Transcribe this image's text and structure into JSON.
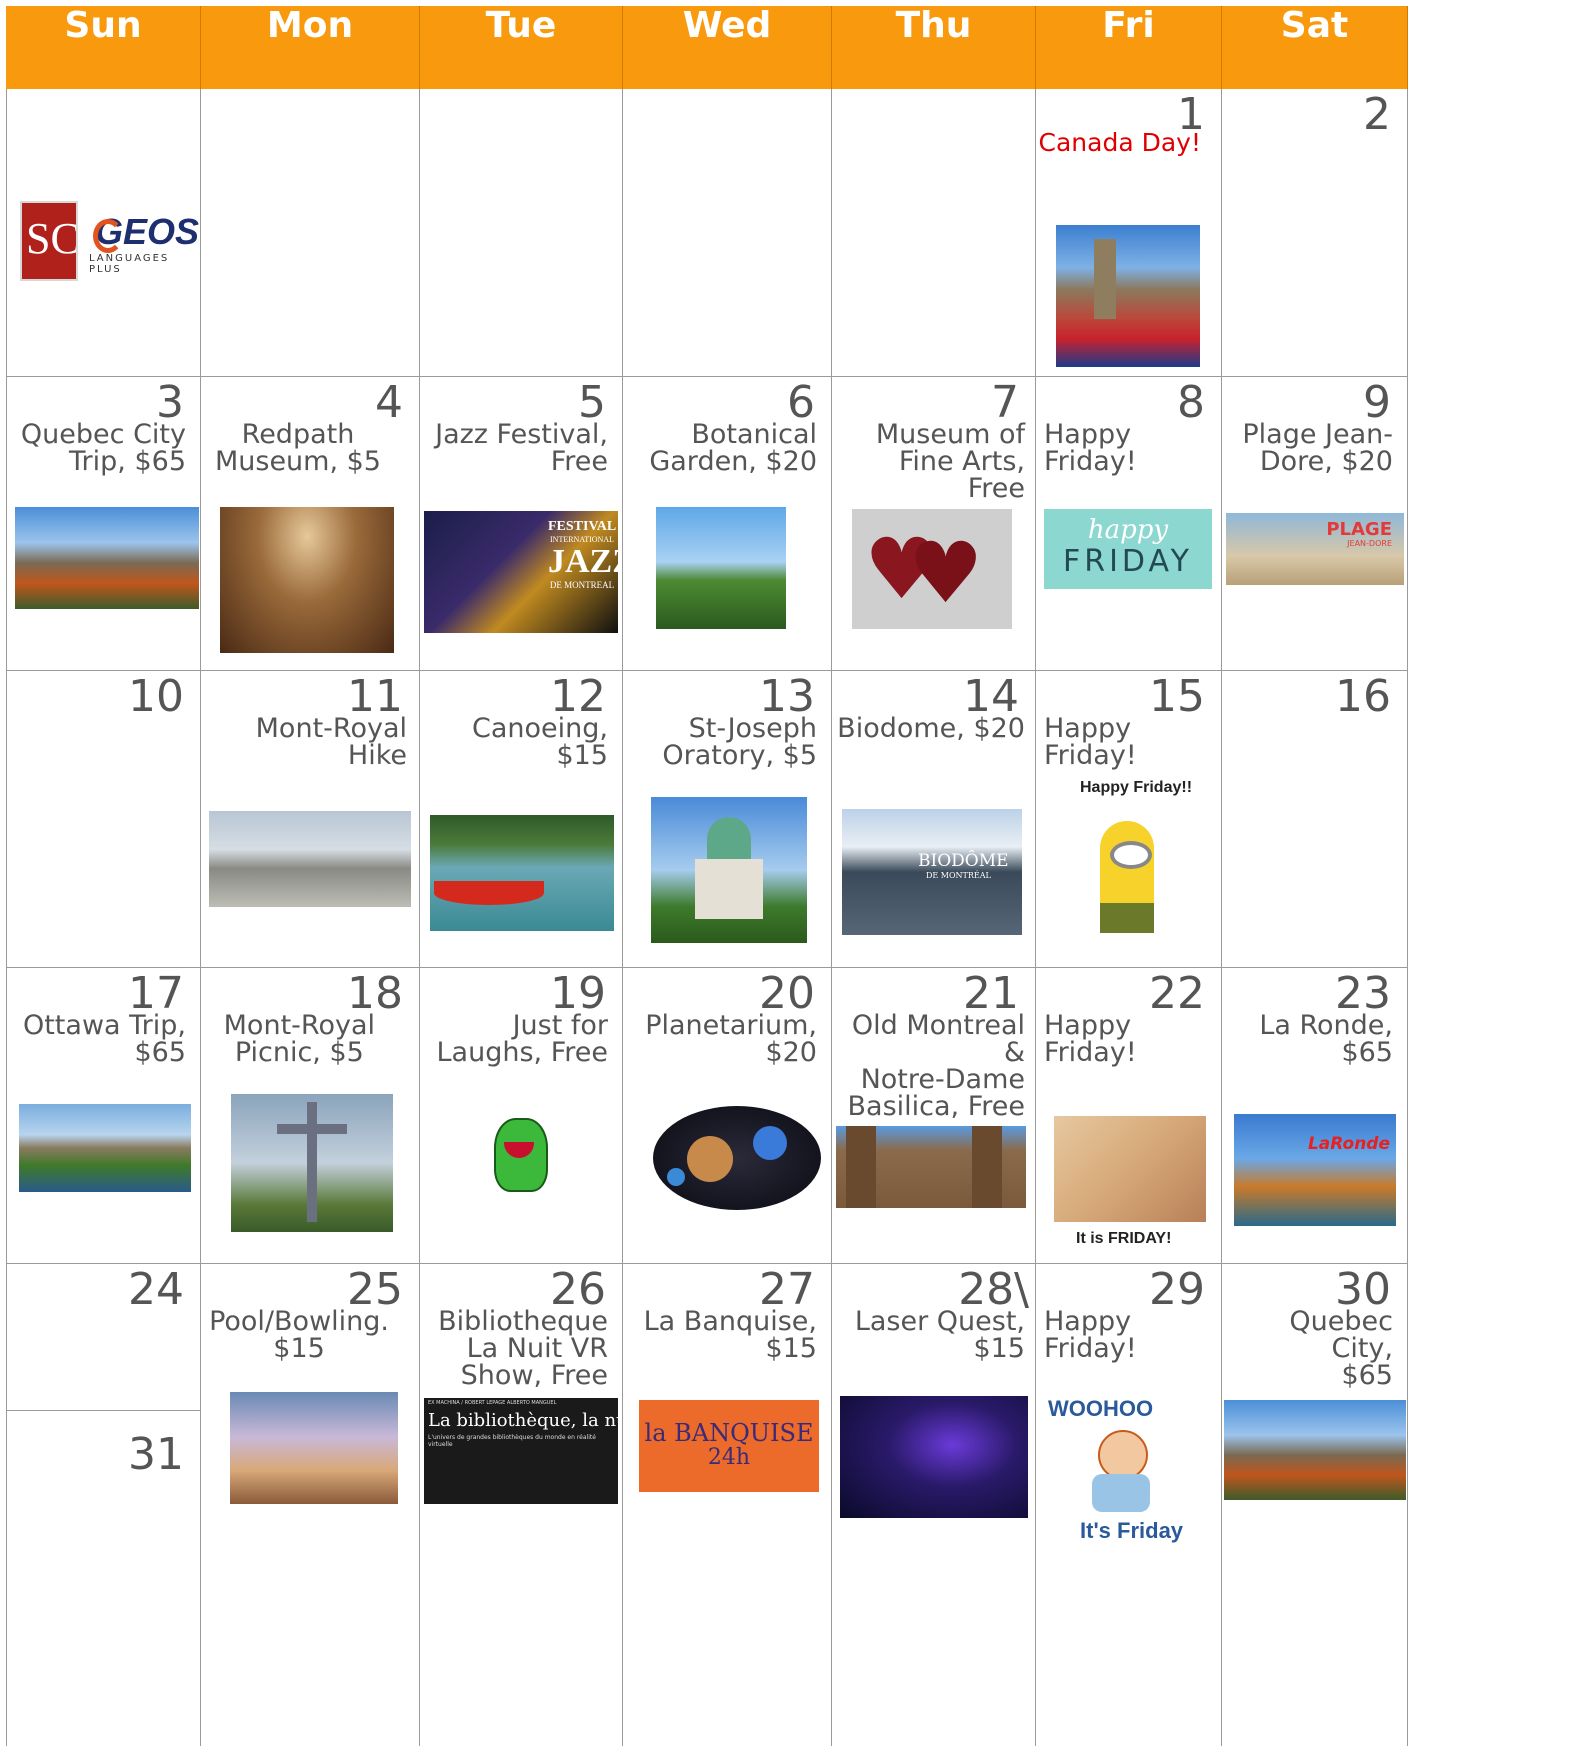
{
  "weekdays": [
    "Sun",
    "Mon",
    "Tue",
    "Wed",
    "Thu",
    "Fri",
    "Sat"
  ],
  "logo": {
    "sc_text": "SC",
    "geos_text": "GEOS",
    "geos_sub": "LANGUAGES PLUS"
  },
  "days": {
    "d1": {
      "num": "1",
      "event": "Canada Day!"
    },
    "d2": {
      "num": "2",
      "event": ""
    },
    "d3": {
      "num": "3",
      "event": "Quebec City\nTrip, $65"
    },
    "d4": {
      "num": "4",
      "event": "Redpath\nMuseum, $5"
    },
    "d5": {
      "num": "5",
      "event": "Jazz Festival,\nFree"
    },
    "d6": {
      "num": "6",
      "event": "Botanical\nGarden, $20"
    },
    "d7": {
      "num": "7",
      "event": "Museum of\nFine Arts,\nFree"
    },
    "d8": {
      "num": "8",
      "event": "Happy Friday!"
    },
    "d9": {
      "num": "9",
      "event": "Plage Jean-\nDore, $20"
    },
    "d10": {
      "num": "10",
      "event": ""
    },
    "d11": {
      "num": "11",
      "event": "Mont-Royal Hike"
    },
    "d12": {
      "num": "12",
      "event": "Canoeing, $15"
    },
    "d13": {
      "num": "13",
      "event": "St-Joseph\nOratory, $5"
    },
    "d14": {
      "num": "14",
      "event": "Biodome, $20"
    },
    "d15": {
      "num": "15",
      "event": "Happy Friday!"
    },
    "d16": {
      "num": "16",
      "event": ""
    },
    "d17": {
      "num": "17",
      "event": "Ottawa Trip,\n$65"
    },
    "d18": {
      "num": "18",
      "event": "Mont-Royal\nPicnic, $5"
    },
    "d19": {
      "num": "19",
      "event": "Just for\nLaughs, Free"
    },
    "d20": {
      "num": "20",
      "event": "Planetarium,\n$20"
    },
    "d21": {
      "num": "21",
      "event": "Old Montreal &\nNotre-Dame\nBasilica, Free"
    },
    "d22": {
      "num": "22",
      "event": "Happy Friday!"
    },
    "d23": {
      "num": "23",
      "event": "La Ronde,\n$65"
    },
    "d24": {
      "num": "24",
      "event": ""
    },
    "d25": {
      "num": "25",
      "event": "Pool/Bowling.\n$15"
    },
    "d26": {
      "num": "26",
      "event": "Bibliotheque\nLa Nuit VR\nShow, Free"
    },
    "d27": {
      "num": "27",
      "event": "La Banquise,\n$15"
    },
    "d28": {
      "num": "28\\",
      "event": "Laser Quest,\n$15"
    },
    "d29": {
      "num": "29",
      "event": "Happy Friday!"
    },
    "d30": {
      "num": "30",
      "event": "Quebec City,\n$65"
    },
    "d31": {
      "num": "31",
      "event": ""
    }
  },
  "image_text": {
    "happy_friday_word1": "happy",
    "happy_friday_word2": "FRIDAY",
    "plage_title": "PLAGE",
    "plage_sub": "JEAN-DORE",
    "jazz_line1": "FESTIVAL",
    "jazz_line2": "INTERNATIONAL",
    "jazz_line3": "JAZZ",
    "jazz_line4": "DE MONTREAL",
    "biodome_sign": "BIODÔME",
    "biodome_sub": "DE MONTRÉAL",
    "minion_caption": "Happy Friday!!",
    "baby_caption": "It is FRIDAY!",
    "laronde_sign": "LaRonde",
    "biblio_top": "EX MACHINA / ROBERT LEPAGE     ALBERTO MANGUEL",
    "biblio_title": "La bibliothèque, la nuit",
    "biblio_sub": "L'univers de grandes bibliothèques du monde en réalité virtuelle",
    "banquise_line1": "la BANQUISE",
    "banquise_line2": "24h",
    "woohoo_top": "WOOHOO",
    "woohoo_bottom": "It's Friday"
  },
  "colors": {
    "header": "#f99a0e",
    "header_text": "#ffffff",
    "grid": "#9a9a9a",
    "canada_day": "#e00000",
    "text": "#555555"
  }
}
